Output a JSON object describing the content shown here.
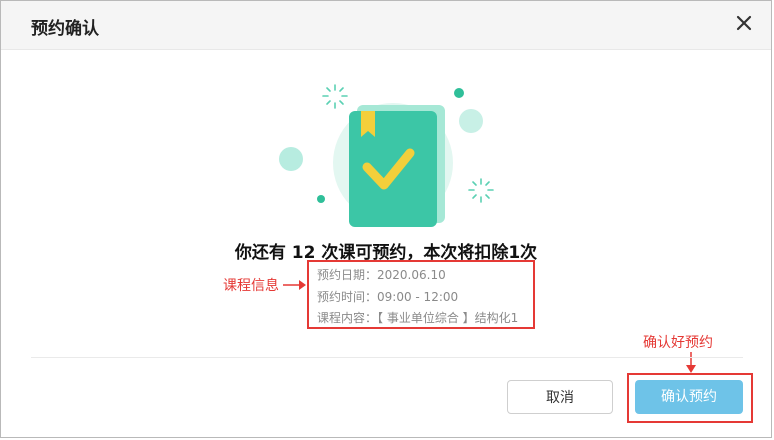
{
  "dialog": {
    "title": "预约确认",
    "close_icon": "close-icon"
  },
  "headline": "你还有 12 次课可预约，本次将扣除1次",
  "info": {
    "date_label": "预约日期：",
    "date_value": "2020.06.10",
    "time_label": "预约时间：",
    "time_value": "09:00 - 12:00",
    "content_label": "课程内容：",
    "content_value": "【 事业单位综合 】结构化1"
  },
  "annotations": {
    "course_info": "课程信息",
    "confirm_hint": "确认好预约"
  },
  "buttons": {
    "cancel": "取消",
    "confirm": "确认预约"
  },
  "colors": {
    "accent_button": "#6ec3e8",
    "annotation_red": "#e53935",
    "book_green": "#3cc6a6",
    "bookmark_yellow": "#f3cf3b"
  },
  "illustration_icon": "book-check-icon"
}
